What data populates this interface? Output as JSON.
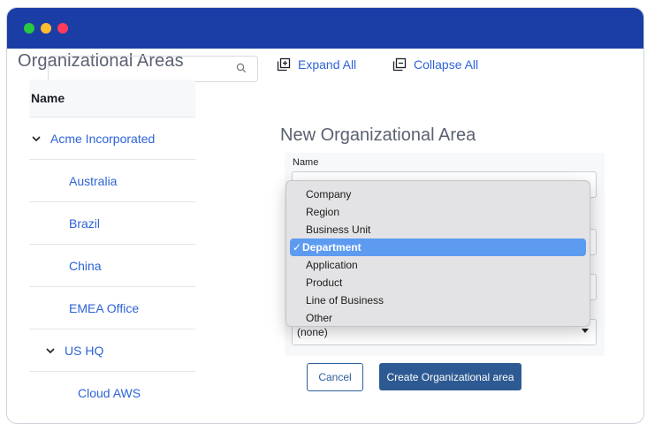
{
  "window": {
    "controls": [
      "green",
      "yellow",
      "red"
    ]
  },
  "page": {
    "title": "Organizational Areas"
  },
  "search": {
    "placeholder": "",
    "icon": "search-icon"
  },
  "toolbar": {
    "expand_all": "Expand All",
    "collapse_all": "Collapse All"
  },
  "tree": {
    "header": "Name",
    "items": [
      {
        "label": "Acme Incorporated",
        "expanded": true
      },
      {
        "label": "Australia"
      },
      {
        "label": "Brazil"
      },
      {
        "label": "China"
      },
      {
        "label": "EMEA Office"
      },
      {
        "label": "US HQ",
        "expanded": true
      },
      {
        "label": "Cloud AWS"
      }
    ]
  },
  "form": {
    "title": "New Organizational Area",
    "name_label": "Name",
    "select_value": "(none)",
    "cancel": "Cancel",
    "create": "Create Organizational area"
  },
  "dropdown": {
    "check": "✓",
    "options": [
      "Company",
      "Region",
      "Business Unit",
      "Department",
      "Application",
      "Product",
      "Line of Business",
      "Other"
    ],
    "selected": "Department"
  },
  "colors": {
    "titlebar": "#1a3ea6",
    "link": "#2d63d6",
    "primary_button": "#2d5a92",
    "selection": "#5d9bf0"
  }
}
